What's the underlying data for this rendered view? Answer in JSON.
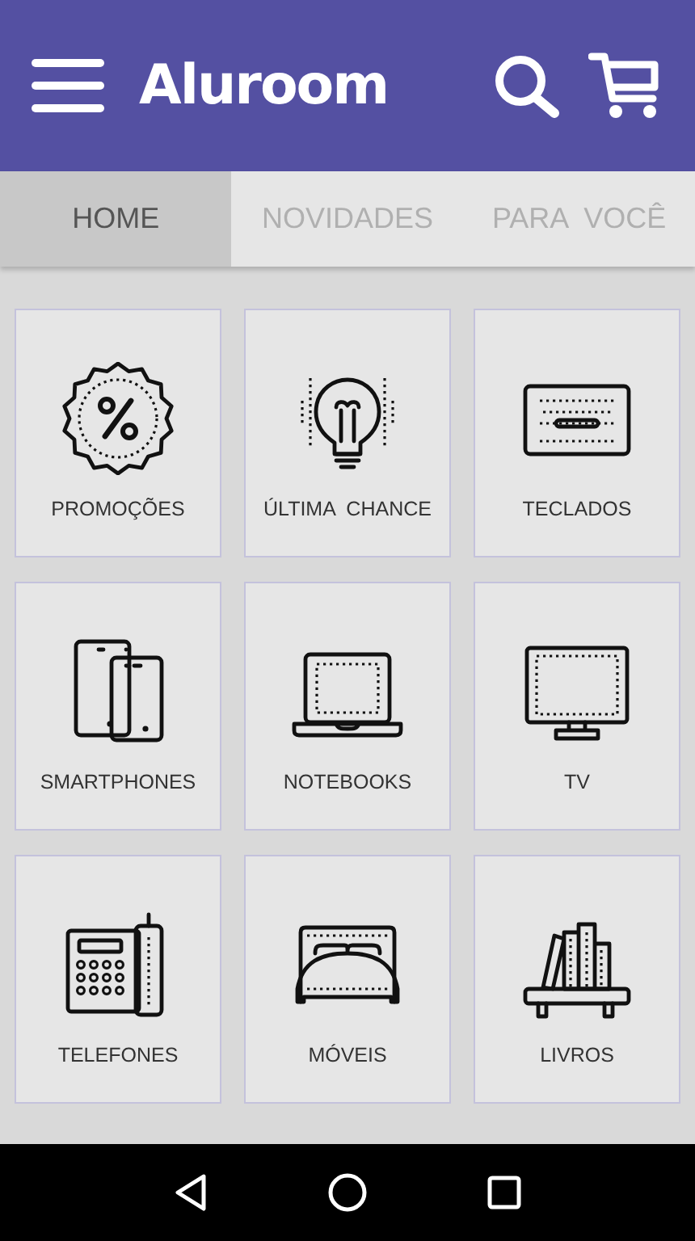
{
  "app_bar": {
    "logo": "Aluroom"
  },
  "tabs": [
    {
      "label": "HOME",
      "selected": true
    },
    {
      "label": "NOVIDADES",
      "selected": false
    },
    {
      "label": "PARA  VOCÊ",
      "selected": false
    }
  ],
  "categories": [
    {
      "label": "PROMOÇÕES",
      "kind": "badge"
    },
    {
      "label": "ÚLTIMA  CHANCE",
      "kind": "bulb"
    },
    {
      "label": "TECLADOS",
      "kind": "keyboard"
    },
    {
      "label": "SMARTPHONES",
      "kind": "devices"
    },
    {
      "label": "NOTEBOOKS",
      "kind": "laptop"
    },
    {
      "label": "TV",
      "kind": "tv"
    },
    {
      "label": "TELEFONES",
      "kind": "phone"
    },
    {
      "label": "MÓVEIS",
      "kind": "bed"
    },
    {
      "label": "LIVROS",
      "kind": "books"
    }
  ]
}
